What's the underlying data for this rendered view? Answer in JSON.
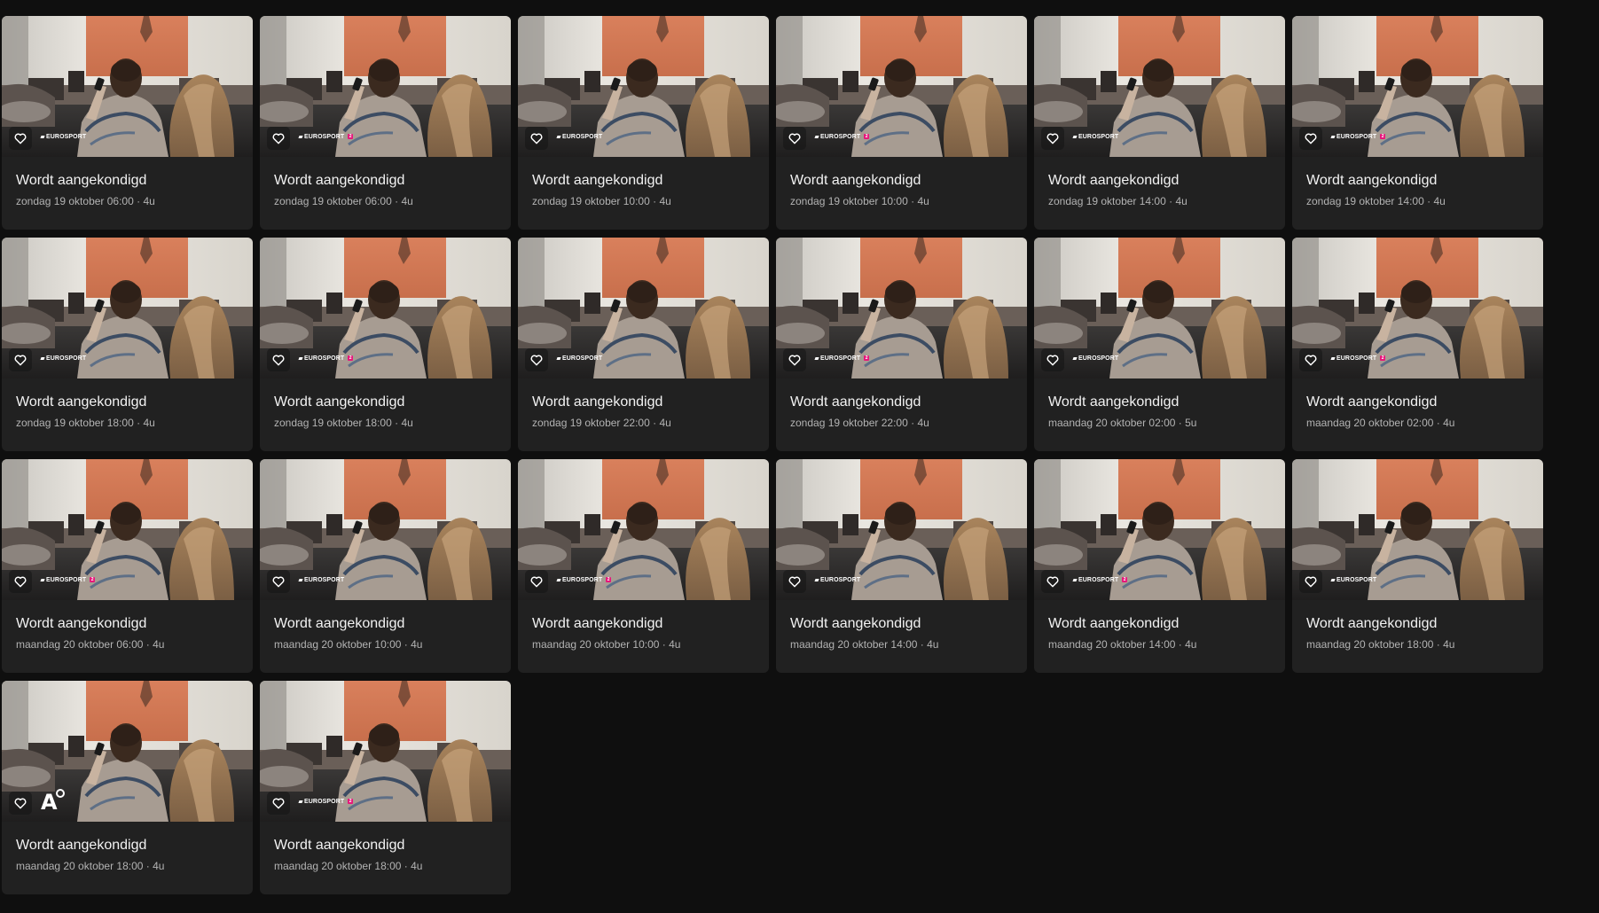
{
  "cards": [
    {
      "title": "Wordt aangekondigd",
      "meta": "zondag 19 oktober 06:00 · 4u",
      "channel_logo": "EUROSPORT"
    },
    {
      "title": "Wordt aangekondigd",
      "meta": "zondag 19 oktober 06:00 · 4u",
      "channel_logo": "EUROSPORT 2"
    },
    {
      "title": "Wordt aangekondigd",
      "meta": "zondag 19 oktober 10:00 · 4u",
      "channel_logo": "EUROSPORT"
    },
    {
      "title": "Wordt aangekondigd",
      "meta": "zondag 19 oktober 10:00 · 4u",
      "channel_logo": "EUROSPORT 2"
    },
    {
      "title": "Wordt aangekondigd",
      "meta": "zondag 19 oktober 14:00 · 4u",
      "channel_logo": "EUROSPORT"
    },
    {
      "title": "Wordt aangekondigd",
      "meta": "zondag 19 oktober 14:00 · 4u",
      "channel_logo": "EUROSPORT 2"
    },
    {
      "title": "Wordt aangekondigd",
      "meta": "zondag 19 oktober 18:00 · 4u",
      "channel_logo": "EUROSPORT"
    },
    {
      "title": "Wordt aangekondigd",
      "meta": "zondag 19 oktober 18:00 · 4u",
      "channel_logo": "EUROSPORT 2"
    },
    {
      "title": "Wordt aangekondigd",
      "meta": "zondag 19 oktober 22:00 · 4u",
      "channel_logo": "EUROSPORT"
    },
    {
      "title": "Wordt aangekondigd",
      "meta": "zondag 19 oktober 22:00 · 4u",
      "channel_logo": "EUROSPORT 2"
    },
    {
      "title": "Wordt aangekondigd",
      "meta": "maandag 20 oktober 02:00 · 5u",
      "channel_logo": "EUROSPORT"
    },
    {
      "title": "Wordt aangekondigd",
      "meta": "maandag 20 oktober 02:00 · 4u",
      "channel_logo": "EUROSPORT 2"
    },
    {
      "title": "Wordt aangekondigd",
      "meta": "maandag 20 oktober 06:00 · 4u",
      "channel_logo": "EUROSPORT 2"
    },
    {
      "title": "Wordt aangekondigd",
      "meta": "maandag 20 oktober 10:00 · 4u",
      "channel_logo": "EUROSPORT"
    },
    {
      "title": "Wordt aangekondigd",
      "meta": "maandag 20 oktober 10:00 · 4u",
      "channel_logo": "EUROSPORT 2"
    },
    {
      "title": "Wordt aangekondigd",
      "meta": "maandag 20 oktober 14:00 · 4u",
      "channel_logo": "EUROSPORT"
    },
    {
      "title": "Wordt aangekondigd",
      "meta": "maandag 20 oktober 14:00 · 4u",
      "channel_logo": "EUROSPORT 2"
    },
    {
      "title": "Wordt aangekondigd",
      "meta": "maandag 20 oktober 18:00 · 4u",
      "channel_logo": "EUROSPORT"
    },
    {
      "title": "Wordt aangekondigd",
      "meta": "maandag 20 oktober 18:00 · 4u",
      "channel_logo": "A"
    },
    {
      "title": "Wordt aangekondigd",
      "meta": "maandag 20 oktober 18:00 · 4u",
      "channel_logo": "EUROSPORT 2"
    }
  ],
  "icons": {
    "favorite": "heart-outline-icon"
  },
  "colors": {
    "background": "#0f0f0f",
    "card": "#212121",
    "title": "#f2f2f2",
    "meta": "#b3b3b3",
    "eurosport2_accent": "#e6177b"
  }
}
